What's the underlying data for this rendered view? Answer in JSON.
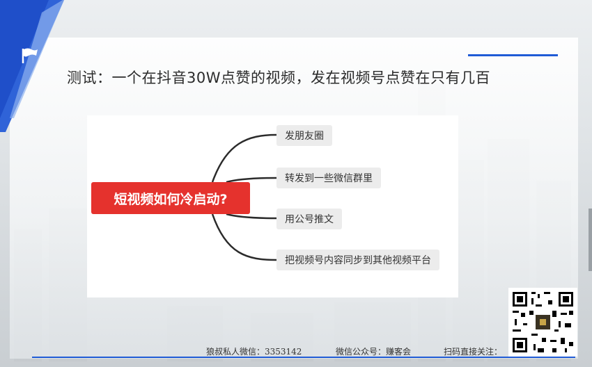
{
  "slide": {
    "title": "测试：一个在抖音30W点赞的视频，发在视频号点赞在只有几百"
  },
  "mindmap": {
    "root": "短视频如何冷启动?",
    "branches": [
      "发朋友圈",
      "转发到一些微信群里",
      "用公号推文",
      "把视频号内容同步到其他视频平台"
    ]
  },
  "footer": {
    "wechat": "狼叔私人微信：3353142",
    "public_account": "微信公众号：赚客会",
    "scan": "扫码直接关注："
  },
  "colors": {
    "accent_blue": "#1f5bd6",
    "root_red": "#e5322d",
    "branch_gray": "#ececec"
  },
  "icons": [
    "flag-icon",
    "qr-code"
  ]
}
